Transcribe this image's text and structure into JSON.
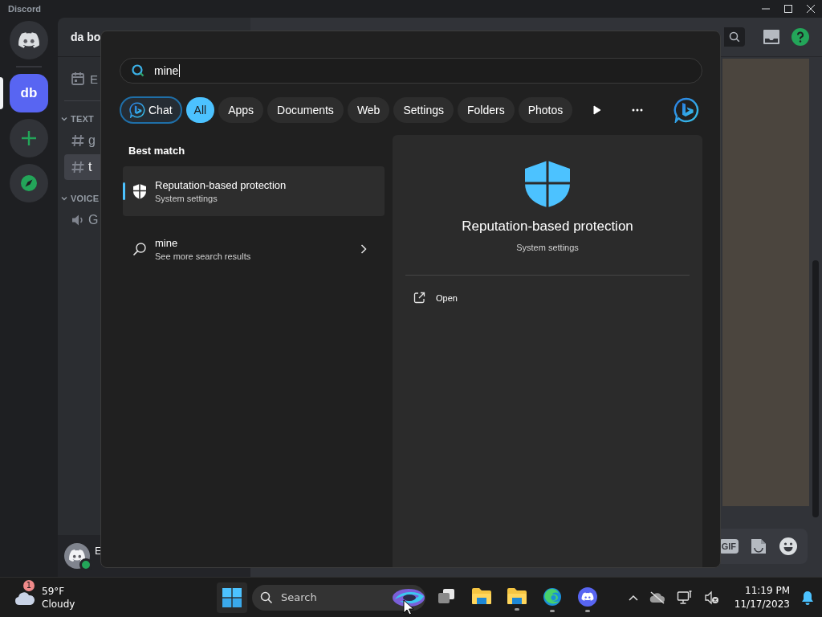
{
  "discord": {
    "title": "Discord",
    "servers": [
      {
        "kind": "home",
        "selected": false
      },
      {
        "kind": "server",
        "label": "db",
        "selected": true
      },
      {
        "kind": "add",
        "selected": false
      },
      {
        "kind": "explore",
        "selected": false
      }
    ],
    "server_name": "da bo",
    "events": "E",
    "categories": [
      {
        "name": "TEXT",
        "expanded": true,
        "channels": [
          {
            "kind": "text",
            "name": "g",
            "selected": false
          },
          {
            "kind": "text",
            "name": "t",
            "selected": true
          }
        ]
      },
      {
        "name": "VOICE",
        "expanded": true,
        "channels": [
          {
            "kind": "voice",
            "name": "G",
            "selected": false
          }
        ]
      }
    ],
    "user": {
      "name": "E",
      "online": true
    },
    "composer": {
      "gif": "GIF"
    }
  },
  "search_panel": {
    "query": "mine",
    "chat_button": "Chat",
    "filters": [
      {
        "label": "All",
        "selected": true
      },
      {
        "label": "Apps",
        "selected": false
      },
      {
        "label": "Documents",
        "selected": false
      },
      {
        "label": "Web",
        "selected": false
      },
      {
        "label": "Settings",
        "selected": false
      },
      {
        "label": "Folders",
        "selected": false
      },
      {
        "label": "Photos",
        "selected": false
      }
    ],
    "section_title": "Best match",
    "results": [
      {
        "kind": "setting",
        "title": "Reputation-based protection",
        "subtitle": "System settings",
        "selected": true
      },
      {
        "kind": "web",
        "title": "mine",
        "subtitle": "See more search results",
        "selected": false
      }
    ],
    "preview": {
      "title": "Reputation-based protection",
      "subtitle": "System settings",
      "actions": [
        {
          "label": "Open"
        }
      ]
    }
  },
  "taskbar": {
    "weather": {
      "badge": "1",
      "temperature": "59°F",
      "condition": "Cloudy"
    },
    "search_placeholder": "Search",
    "apps": [
      {
        "kind": "taskview",
        "running": false
      },
      {
        "kind": "folder",
        "running": false
      },
      {
        "kind": "folder",
        "running": true
      },
      {
        "kind": "edge",
        "running": true
      },
      {
        "kind": "discord",
        "running": true
      }
    ],
    "time": "11:19 PM",
    "date": "11/17/2023"
  }
}
